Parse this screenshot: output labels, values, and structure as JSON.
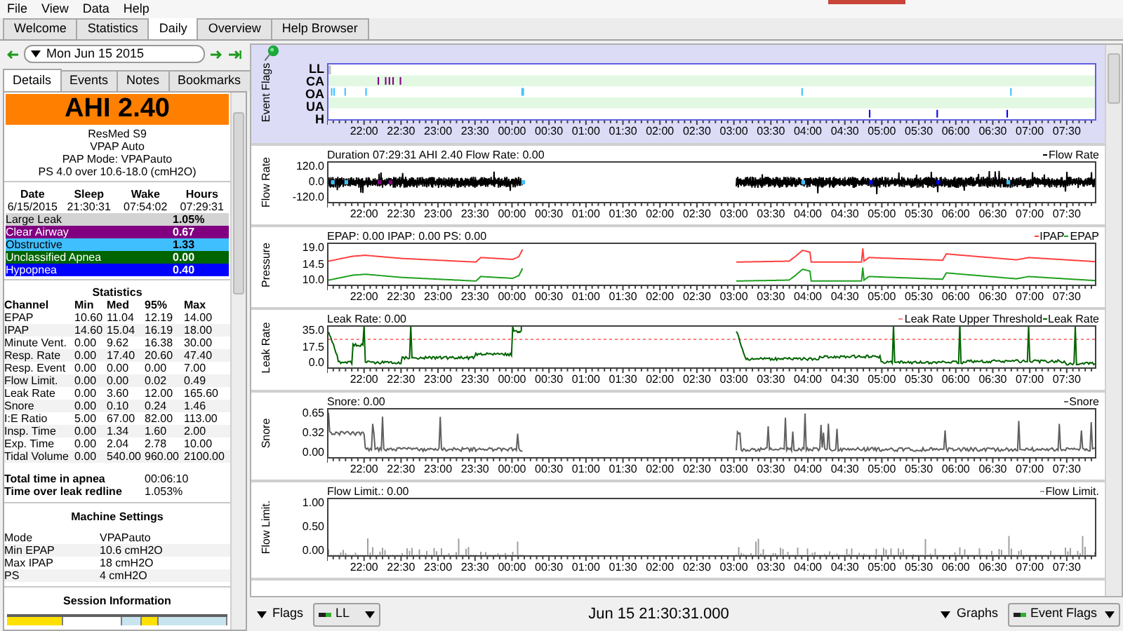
{
  "menu": [
    "File",
    "View",
    "Data",
    "Help"
  ],
  "tabs": [
    {
      "label": "Welcome",
      "selected": false
    },
    {
      "label": "Statistics",
      "selected": false
    },
    {
      "label": "Daily",
      "selected": true
    },
    {
      "label": "Overview",
      "selected": false
    },
    {
      "label": "Help Browser",
      "selected": false
    }
  ],
  "date_nav": {
    "date": "Mon Jun 15 2015"
  },
  "detail_tabs": [
    {
      "label": "Details",
      "selected": true
    },
    {
      "label": "Events",
      "selected": false
    },
    {
      "label": "Notes",
      "selected": false
    },
    {
      "label": "Bookmarks",
      "selected": false
    }
  ],
  "summary": {
    "ahi": "AHI 2.40",
    "lines": [
      "ResMed S9",
      "VPAP Auto",
      "PAP Mode: VPAPauto",
      "PS 4.0 over 10.6-18.0 (cmH2O)"
    ]
  },
  "sleep_table": {
    "columns": [
      "Date",
      "Sleep",
      "Wake",
      "Hours"
    ],
    "row": [
      "6/15/2015",
      "21:30:31",
      "07:54:02",
      "07:29:31"
    ]
  },
  "event_indices": [
    {
      "label": "Large Leak",
      "value": "1.05%",
      "color": "#d3d3d3"
    },
    {
      "label": "Clear Airway",
      "value": "0.67",
      "color": "#800080"
    },
    {
      "label": "Obstructive",
      "value": "1.33",
      "color": "#40bfff"
    },
    {
      "label": "Unclassified Apnea",
      "value": "0.00",
      "color": "#006400"
    },
    {
      "label": "Hypopnea",
      "value": "0.40",
      "color": "#0000ff"
    }
  ],
  "statistics": {
    "title": "Statistics",
    "columns": [
      "Channel",
      "Min",
      "Med",
      "95%",
      "Max"
    ],
    "rows": [
      [
        "EPAP",
        "10.60",
        "11.04",
        "12.19",
        "14.00"
      ],
      [
        "IPAP",
        "14.60",
        "15.04",
        "16.19",
        "18.00"
      ],
      [
        "Minute Vent.",
        "0.00",
        "9.62",
        "16.38",
        "30.00"
      ],
      [
        "Resp. Rate",
        "0.00",
        "17.40",
        "20.60",
        "47.40"
      ],
      [
        "Resp. Event",
        "0.00",
        "0.00",
        "0.00",
        "7.00"
      ],
      [
        "Flow Limit.",
        "0.00",
        "0.00",
        "0.02",
        "0.49"
      ],
      [
        "Leak Rate",
        "0.00",
        "3.60",
        "12.00",
        "165.60"
      ],
      [
        "Snore",
        "0.00",
        "0.10",
        "0.24",
        "1.46"
      ],
      [
        "I:E Ratio",
        "5.00",
        "67.00",
        "82.00",
        "113.00"
      ],
      [
        "Insp. Time",
        "0.00",
        "1.34",
        "1.60",
        "2.00"
      ],
      [
        "Exp. Time",
        "0.00",
        "2.04",
        "2.78",
        "10.00"
      ],
      [
        "Tidal Volume",
        "0.00",
        "540.00",
        "960.00",
        "2100.00"
      ]
    ]
  },
  "totals": [
    {
      "label": "Total time in apnea",
      "value": "00:06:10"
    },
    {
      "label": "Time over leak redline",
      "value": "1.053%"
    }
  ],
  "machine_settings": {
    "title": "Machine Settings",
    "rows": [
      [
        "Mode",
        "VPAPauto"
      ],
      [
        "Min EPAP",
        "10.6 cmH2O"
      ],
      [
        "Max IPAP",
        "18 cmH2O"
      ],
      [
        "PS",
        "4 cmH2O"
      ]
    ]
  },
  "session_information": {
    "title": "Session Information"
  },
  "graphs": [
    {
      "kind": "flags",
      "axis_title": "Event Flags",
      "yticks": [
        "LL",
        "CA",
        "OA",
        "UA",
        "H"
      ],
      "xticks": [
        "22:00",
        "22:30",
        "23:00",
        "23:30",
        "00:00",
        "00:30",
        "01:00",
        "01:30",
        "02:00",
        "02:30",
        "03:00",
        "03:30",
        "04:00",
        "04:30",
        "05:00",
        "05:30",
        "06:00",
        "06:30",
        "07:00",
        "07:30"
      ]
    },
    {
      "kind": "flow",
      "axis_title": "Flow Rate",
      "header": "Duration 07:29:31 AHI 2.40 Flow Rate: 0.00",
      "legend": [
        {
          "label": "Flow Rate",
          "color": "#000000"
        }
      ],
      "yticks": [
        "120.0",
        "0.0",
        "-120.0"
      ],
      "xticks": [
        "22:00",
        "22:30",
        "23:00",
        "23:30",
        "00:00",
        "00:30",
        "01:00",
        "01:30",
        "02:00",
        "02:30",
        "03:00",
        "03:30",
        "04:00",
        "04:30",
        "05:00",
        "05:30",
        "06:00",
        "06:30",
        "07:00",
        "07:30"
      ]
    },
    {
      "kind": "pressure",
      "axis_title": "Pressure",
      "header": "EPAP: 0.00 IPAP: 0.00 PS: 0.00",
      "legend": [
        {
          "label": "IPAP",
          "color": "#ff4040"
        },
        {
          "label": "EPAP",
          "color": "#20a020"
        }
      ],
      "yticks": [
        "19.0",
        "14.5",
        "10.0"
      ],
      "xticks": [
        "22:00",
        "22:30",
        "23:00",
        "23:30",
        "00:00",
        "00:30",
        "01:00",
        "01:30",
        "02:00",
        "02:30",
        "03:00",
        "03:30",
        "04:00",
        "04:30",
        "05:00",
        "05:30",
        "06:00",
        "06:30",
        "07:00",
        "07:30"
      ]
    },
    {
      "kind": "leak",
      "axis_title": "Leak Rate",
      "header": "Leak Rate: 0.00",
      "legend": [
        {
          "label": "Leak Rate Upper Threshold",
          "color": "#ff8080"
        },
        {
          "label": "Leak Rate",
          "color": "#006400"
        }
      ],
      "yticks": [
        "35.0",
        "17.5",
        "0.0"
      ],
      "xticks": [
        "22:00",
        "22:30",
        "23:00",
        "23:30",
        "00:00",
        "00:30",
        "01:00",
        "01:30",
        "02:00",
        "02:30",
        "03:00",
        "03:30",
        "04:00",
        "04:30",
        "05:00",
        "05:30",
        "06:00",
        "06:30",
        "07:00",
        "07:30"
      ]
    },
    {
      "kind": "snore",
      "axis_title": "Snore",
      "header": "Snore: 0.00",
      "legend": [
        {
          "label": "Snore",
          "color": "#606060"
        }
      ],
      "yticks": [
        "0.65",
        "0.32",
        "0.00"
      ],
      "xticks": [
        "22:00",
        "22:30",
        "23:00",
        "23:30",
        "00:00",
        "00:30",
        "01:00",
        "01:30",
        "02:00",
        "02:30",
        "03:00",
        "03:30",
        "04:00",
        "04:30",
        "05:00",
        "05:30",
        "06:00",
        "06:30",
        "07:00",
        "07:30"
      ]
    },
    {
      "kind": "flow_limit",
      "axis_title": "Flow Limit.",
      "header": "Flow Limit.: 0.00",
      "legend": [
        {
          "label": "Flow Limit.",
          "color": "#a0a0a0"
        }
      ],
      "yticks": [
        "1.00",
        "0.50",
        "0.00"
      ],
      "xticks": [
        "22:00",
        "22:30",
        "23:00",
        "23:30",
        "00:00",
        "00:30",
        "01:00",
        "01:30",
        "02:00",
        "02:30",
        "03:00",
        "03:30",
        "04:00",
        "04:30",
        "05:00",
        "05:30",
        "06:00",
        "06:30",
        "07:00",
        "07:30"
      ]
    }
  ],
  "bottom_bar": {
    "flags_label": "Flags",
    "flags_value": "LL",
    "timestamp": "Jun 15 21:30:31.000",
    "graphs_label": "Graphs",
    "graphs_value": "Event Flags"
  }
}
